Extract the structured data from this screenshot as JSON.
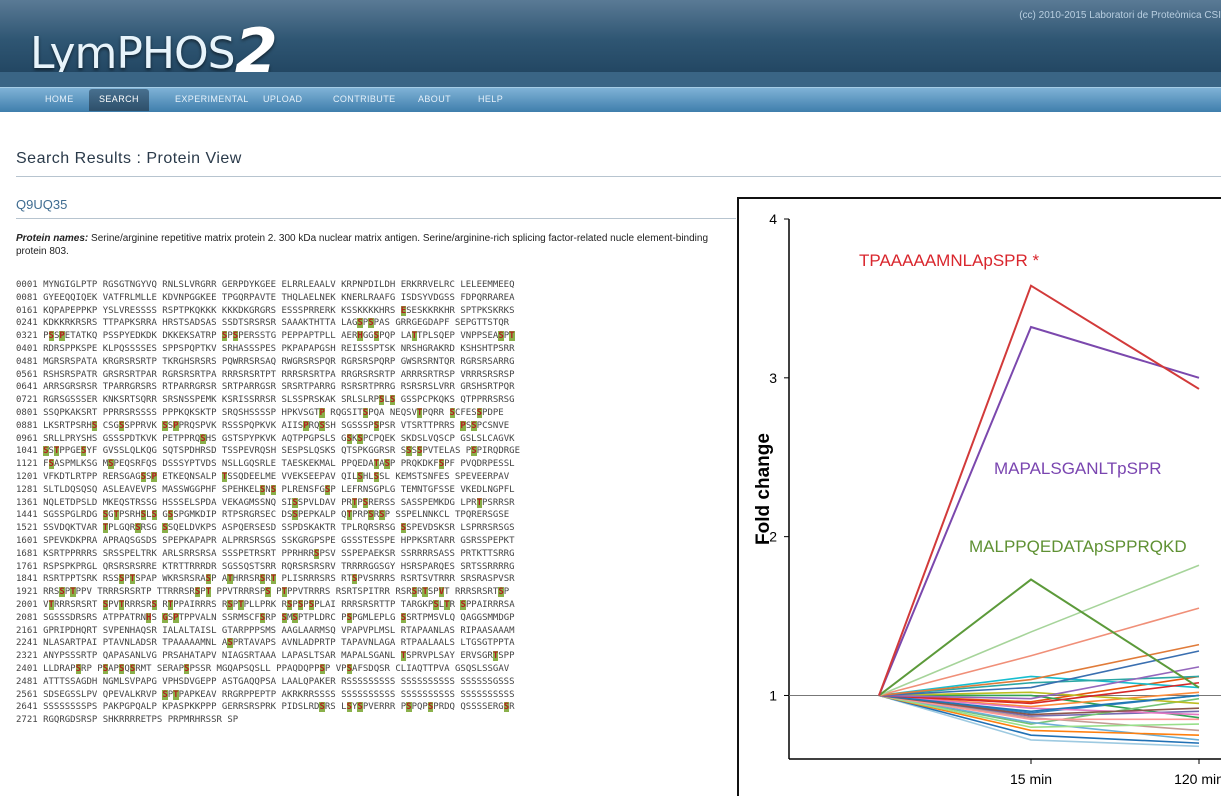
{
  "app": {
    "logo_text": "LymPHOS",
    "logo_number": "2",
    "copyright": "(cc) 2010-2015 Laboratori de Proteòmica CSI"
  },
  "nav": {
    "items": [
      "HOME",
      "SEARCH",
      "EXPERIMENTAL",
      "UPLOAD",
      "CONTRIBUTE",
      "ABOUT",
      "HELP"
    ],
    "active": "SEARCH"
  },
  "page": {
    "title": "Search Results : Protein View",
    "accession": "Q9UQ35",
    "protein_names_label": "Protein names:",
    "protein_names_text": "Serine/arginine repetitive matrix protein 2. 300 kDa nuclear matrix antigen. Serine/arginine-rich splicing factor-related nucle element-binding protein 803."
  },
  "sequence_lines": [
    [
      {
        "t": "0001 MYNGIGLPTP RGSGTNGYVQ RNLSLVRGRR GERPDYKGEE ELRRLEAALV KRPNPDILDH ERKRRVELRC LELEEMMEEQ"
      }
    ],
    [
      {
        "t": "0081 GYEEQQIQEK VATFRLMLLE KDVNPGGKEE TPGQRPAVTE THQLAELNEK KNERLRAAFG ISDSYVDGSS FDPQRRAREA"
      }
    ],
    [
      {
        "t": "0161 KQPAPEPPKP YSLVRESSSS RSPTPKQKKK KKKDKGRGRS ESSSPRRERK KSSKKKKHRS "
      },
      {
        "t": "E",
        "h": 1
      },
      {
        "t": "SESKKRKHR SPTPKSKRKS"
      }
    ],
    [
      {
        "t": "0241 KDKKRKRSRS TTPAPKSRRA HRSTSADSAS SSDTSRSRSR SAAAKTHTTA LAG"
      },
      {
        "t": "S",
        "h": 1
      },
      {
        "t": "P"
      },
      {
        "t": "S",
        "h": 1
      },
      {
        "t": "PAS GRRGEGDAPF SEPGTTSTQR"
      }
    ],
    [
      {
        "t": "0321 P"
      },
      {
        "t": "S",
        "h": 1
      },
      {
        "t": "S"
      },
      {
        "t": "P",
        "h": 1
      },
      {
        "t": "ETATKQ PSSPYEDKDK DKKEKSATRP "
      },
      {
        "t": "S",
        "h": 1
      },
      {
        "t": "P"
      },
      {
        "t": "S",
        "h": 1
      },
      {
        "t": "PERSSTG PEPPAPTPLL AER"
      },
      {
        "t": "H",
        "h": 1
      },
      {
        "t": "GG"
      },
      {
        "t": "S",
        "h": 1
      },
      {
        "t": "PQP LA"
      },
      {
        "t": "T",
        "h": 1
      },
      {
        "t": "TPLSQEP VNPPSEA"
      },
      {
        "t": "S",
        "h": 1
      },
      {
        "t": "P"
      },
      {
        "t": "T",
        "h": 1
      }
    ],
    [
      {
        "t": "0401 RDRSPPKSPE KLPQSSSSES SPPSPQPTKV SRHASSSPES PKPAPAPGSH REISSSPTSK NRSHGRAKRD KSHSHTPSRR"
      }
    ],
    [
      {
        "t": "0481 MGRSRSPATA KRGRSRSRTP TKRGHSRSRS PQWRRSRSAQ RWGRSRSPQR RGRSRSPQRP GWSRSRNTQR RGRSRSARRG"
      }
    ],
    [
      {
        "t": "0561 RSHSRSPATR GRSRSRTPAR RGRSRSRTPA RRRSRSRTPT RRRSRSRTPA RRGRSRSRTP ARRRSRTRSP VRRRSRSRSP"
      }
    ],
    [
      {
        "t": "0641 ARRSGRSRSR TPARRGRSRS RTPARRGRSR SRTPARRGSR SRSRTPARRG RSRSRTPRRG RSRSRSLVRR GRSHSRTPQR"
      }
    ],
    [
      {
        "t": "0721 RGRSGSSSER KNKSRTSQRR SRSNSSPEMK KSRISSRRSR SLSSPRSKAK SRLSLRP"
      },
      {
        "t": "S",
        "h": 1
      },
      {
        "t": "L"
      },
      {
        "t": "S",
        "h": 1
      },
      {
        "t": " GSSPCPKQKS QTPPRRSRSG"
      }
    ],
    [
      {
        "t": "0801 SSQPKAKSRT PPRRSRSSSS PPPKQKSKTP SRQSHSSSSP HPKVSGT"
      },
      {
        "t": "P",
        "h": 1
      },
      {
        "t": " RQGSIT"
      },
      {
        "t": "S",
        "h": 1
      },
      {
        "t": "PQA NEQSV"
      },
      {
        "t": "T",
        "h": 1
      },
      {
        "t": "PQRR "
      },
      {
        "t": "S",
        "h": 1
      },
      {
        "t": "CFES"
      },
      {
        "t": "S",
        "h": 1
      },
      {
        "t": "PDPE"
      }
    ],
    [
      {
        "t": "0881 LKSRTPSRH"
      },
      {
        "t": "S",
        "h": 1
      },
      {
        "t": " CSG"
      },
      {
        "t": "S",
        "h": 1
      },
      {
        "t": "SPPRVK "
      },
      {
        "t": "S",
        "h": 1
      },
      {
        "t": "S"
      },
      {
        "t": "P",
        "h": 1
      },
      {
        "t": "PRQSPVK RSSSPQPKVK AIIS"
      },
      {
        "t": "P",
        "h": 1
      },
      {
        "t": "RQ"
      },
      {
        "t": "S",
        "h": 1
      },
      {
        "t": "SH SGSSSP"
      },
      {
        "t": "S",
        "h": 1
      },
      {
        "t": "PSR VTSRTTPRRS "
      },
      {
        "t": "P",
        "h": 1
      },
      {
        "t": "S"
      },
      {
        "t": "S",
        "h": 1
      },
      {
        "t": "PCSNVE"
      }
    ],
    [
      {
        "t": "0961 SRLLPRYSHS GSSSPDTKVK PETPPRQ"
      },
      {
        "t": "S",
        "h": 1
      },
      {
        "t": "HS GSTSPYPKVK AQTPPGPSLS G"
      },
      {
        "t": "S",
        "h": 1
      },
      {
        "t": "K"
      },
      {
        "t": "S",
        "h": 1
      },
      {
        "t": "PCPQEK SKDSLVQSCP GSLSLCAGVK"
      }
    ],
    [
      {
        "t": "1041 "
      },
      {
        "t": "S",
        "h": 1
      },
      {
        "t": "S"
      },
      {
        "t": "T",
        "h": 1
      },
      {
        "t": "PPGE"
      },
      {
        "t": "S",
        "h": 1
      },
      {
        "t": "YF GVSSLQLKQG SQTSPDHRSD TSSPEVRQSH SESPSLQSKS QTSPKGGRSR S"
      },
      {
        "t": "S",
        "h": 1
      },
      {
        "t": "S"
      },
      {
        "t": "S",
        "h": 1
      },
      {
        "t": "PVTELAS P"
      },
      {
        "t": "S",
        "h": 1
      },
      {
        "t": "PIRQDRGE"
      }
    ],
    [
      {
        "t": "1121 F"
      },
      {
        "t": "S",
        "h": 1
      },
      {
        "t": "ASPMLKSG M"
      },
      {
        "t": "S",
        "h": 1
      },
      {
        "t": "PEQSRFQS DSSSYPTVDS NSLLGQSRLE TAESKEKMAL PPQEDA"
      },
      {
        "t": "T",
        "h": 1
      },
      {
        "t": "A"
      },
      {
        "t": "S",
        "h": 1
      },
      {
        "t": "P PRQKDKF"
      },
      {
        "t": "S",
        "h": 1
      },
      {
        "t": "PF PVQDRPESSL"
      }
    ],
    [
      {
        "t": "1201 VFKDTLRTPP RERSGAG"
      },
      {
        "t": "S",
        "h": 1
      },
      {
        "t": "S"
      },
      {
        "t": "P",
        "h": 1
      },
      {
        "t": " ETKEQNSALP "
      },
      {
        "t": "T",
        "h": 1
      },
      {
        "t": "SSQDEELME VVEKSEEPAV QIL"
      },
      {
        "t": "S",
        "h": 1
      },
      {
        "t": "HL"
      },
      {
        "t": "S",
        "h": 1
      },
      {
        "t": "SL KEMSTSNFES SPEVEERPAV"
      }
    ],
    [
      {
        "t": "1281 SLTLDQSQSQ ASLEAVEVPS MASSWGGPHF SPEHKEL"
      },
      {
        "t": "S",
        "h": 1
      },
      {
        "t": "N"
      },
      {
        "t": "S",
        "h": 1
      },
      {
        "t": " PLRENSFG"
      },
      {
        "t": "S",
        "h": 1
      },
      {
        "t": "P LEFRNSGPLG TEMNTGFSSE VKEDLNGPFL"
      }
    ],
    [
      {
        "t": "1361 NQLETDPSLD MKEQSTRSSG HSSSELSPDA VEKAGMSSNQ SI"
      },
      {
        "t": "S",
        "h": 1
      },
      {
        "t": "SPVLDAV PR"
      },
      {
        "t": "T",
        "h": 1
      },
      {
        "t": "P"
      },
      {
        "t": "S",
        "h": 1
      },
      {
        "t": "RERSS SASSPEMKDG LPR"
      },
      {
        "t": "T",
        "h": 1
      },
      {
        "t": "PSRRSR"
      }
    ],
    [
      {
        "t": "1441 SGSSPGLRDG "
      },
      {
        "t": "S",
        "h": 1
      },
      {
        "t": "G"
      },
      {
        "t": "T",
        "h": 1
      },
      {
        "t": "PSRH"
      },
      {
        "t": "S",
        "h": 1
      },
      {
        "t": "L"
      },
      {
        "t": "S",
        "h": 1
      },
      {
        "t": " G"
      },
      {
        "t": "S",
        "h": 1
      },
      {
        "t": "SPGMKDIP RTPSRGRSEC DS"
      },
      {
        "t": "S",
        "h": 1
      },
      {
        "t": "PEPKALP Q"
      },
      {
        "t": "T",
        "h": 1
      },
      {
        "t": "PRP"
      },
      {
        "t": "S",
        "h": 1
      },
      {
        "t": "R"
      },
      {
        "t": "S",
        "h": 1
      },
      {
        "t": "P SSPELNNKCL TPQRERSGSE"
      }
    ],
    [
      {
        "t": "1521 SSVDQKTVAR "
      },
      {
        "t": "T",
        "h": 1
      },
      {
        "t": "PLGQR"
      },
      {
        "t": "S",
        "h": 1
      },
      {
        "t": "RSG "
      },
      {
        "t": "S",
        "h": 1
      },
      {
        "t": "SQELDVKPS ASPQERSESD SSPDSKAKTR TPLRQRSRSG "
      },
      {
        "t": "S",
        "h": 1
      },
      {
        "t": "SPEVDSKSR LSPRRSRSGS"
      }
    ],
    [
      {
        "t": "1601 SPEVKDKPRA APRAQSGSDS SPEPKAPAPR ALPRRSRSGS SSKGRGPSPE GSSSTESSPE HPPKSRTARR GSRSSPEPKT"
      }
    ],
    [
      {
        "t": "1681 KSRTPPRRRS SRSSPELTRK ARLSRRSRSA SSSPETRSRT PPRHRR"
      },
      {
        "t": "S",
        "h": 1
      },
      {
        "t": "PSV SSPEPAEKSR SSRRRRSASS PRTKTTSRRG"
      }
    ],
    [
      {
        "t": "1761 RSPSPKPRGL QRSRSRSRRE KTRTTRRRDR SGSSQSTSRR RQRSRSRSRV TRRRRGGSGY HSRSPARQES SRTSSRRRRG"
      }
    ],
    [
      {
        "t": "1841 RSRTPPTSRK RSS"
      },
      {
        "t": "S",
        "h": 1
      },
      {
        "t": "P"
      },
      {
        "t": "T",
        "h": 1
      },
      {
        "t": "SPAP WKRSRSRA"
      },
      {
        "t": "S",
        "h": 1
      },
      {
        "t": "P A"
      },
      {
        "t": "T",
        "h": 1
      },
      {
        "t": "HRRSR"
      },
      {
        "t": "S",
        "h": 1
      },
      {
        "t": "R"
      },
      {
        "t": "T",
        "h": 1
      },
      {
        "t": " PLISRRRSRS RT"
      },
      {
        "t": "S",
        "h": 1
      },
      {
        "t": "PVSRRRS RSRTSVTRRR SRSRASPVSR"
      }
    ],
    [
      {
        "t": "1921 RRS"
      },
      {
        "t": "S",
        "h": 1
      },
      {
        "t": "P"
      },
      {
        "t": "T",
        "h": 1
      },
      {
        "t": "PPV TRRRSRSRTP TTRRRSR"
      },
      {
        "t": "S",
        "h": 1
      },
      {
        "t": "P"
      },
      {
        "t": "T",
        "h": 1
      },
      {
        "t": " PPVTRRRSP"
      },
      {
        "t": "S",
        "h": 1
      },
      {
        "t": " P"
      },
      {
        "t": "T",
        "h": 1
      },
      {
        "t": "PPVTRRRS RSRTSPITRR RSR"
      },
      {
        "t": "S",
        "h": 1
      },
      {
        "t": "R"
      },
      {
        "t": "T",
        "h": 1
      },
      {
        "t": "SP"
      },
      {
        "t": "V",
        "h": 1
      },
      {
        "t": "T RRRSRSRT"
      },
      {
        "t": "S",
        "h": 1
      },
      {
        "t": "P"
      }
    ],
    [
      {
        "t": "2001 V"
      },
      {
        "t": "T",
        "h": 1
      },
      {
        "t": "RRRSRSRT "
      },
      {
        "t": "S",
        "h": 1
      },
      {
        "t": "PV"
      },
      {
        "t": "T",
        "h": 1
      },
      {
        "t": "RRRSR"
      },
      {
        "t": "S",
        "h": 1
      },
      {
        "t": " R"
      },
      {
        "t": "T",
        "h": 1
      },
      {
        "t": "PPAIRRRS R"
      },
      {
        "t": "S",
        "h": 1
      },
      {
        "t": "P"
      },
      {
        "t": "T",
        "h": 1
      },
      {
        "t": "PLLPRK R"
      },
      {
        "t": "S",
        "h": 1
      },
      {
        "t": "P"
      },
      {
        "t": "S",
        "h": 1
      },
      {
        "t": "P"
      },
      {
        "t": "S",
        "h": 1
      },
      {
        "t": "PLAI RRRSRSRTTP TARGKP"
      },
      {
        "t": "S",
        "h": 1
      },
      {
        "t": "L"
      },
      {
        "t": "T",
        "h": 1
      },
      {
        "t": "R "
      },
      {
        "t": "S",
        "h": 1
      },
      {
        "t": "PPAIRRRSA"
      }
    ],
    [
      {
        "t": "2081 SGSSSDRSRS ATPPATRN"
      },
      {
        "t": "H",
        "h": 1
      },
      {
        "t": "S "
      },
      {
        "t": "G",
        "h": 1
      },
      {
        "t": "S"
      },
      {
        "t": "P",
        "h": 1
      },
      {
        "t": "TPPVALN SSRMSCF"
      },
      {
        "t": "S",
        "h": 1
      },
      {
        "t": "RP "
      },
      {
        "t": "S",
        "h": 1
      },
      {
        "t": "M"
      },
      {
        "t": "S",
        "h": 1
      },
      {
        "t": "PTPLDRC P"
      },
      {
        "t": "S",
        "h": 1
      },
      {
        "t": "PGMLEPLG "
      },
      {
        "t": "S",
        "h": 1
      },
      {
        "t": "SRTPMSVLQ QAGGSMMDGP"
      }
    ],
    [
      {
        "t": "2161 GPRIPDHQRT SVPENHAQSR IALALTAISL GTARPPPSMS AAGLAARMSQ VPAPVPLMSL RTAPAANLAS RIPAASAAAM"
      }
    ],
    [
      {
        "t": "2241 NLASARTPAI PTAVNLADSR TPAAAAAMNL A"
      },
      {
        "t": "S",
        "h": 1
      },
      {
        "t": "PRTAVAPS AVNLADPRTP TAPAVNLAGA RTPAALAALS LTGSGTPPTA"
      }
    ],
    [
      {
        "t": "2321 ANYPSSSRTP QAPASANLVG PRSAHATAPV NIAGSRTAAA LAPASLTSAR MAPALSGANL "
      },
      {
        "t": "T",
        "h": 1
      },
      {
        "t": "SPRVPLSAY ERVSGR"
      },
      {
        "t": "T",
        "h": 1
      },
      {
        "t": "SPP"
      }
    ],
    [
      {
        "t": "2401 LLDRAP"
      },
      {
        "t": "S",
        "h": 1
      },
      {
        "t": "RP P"
      },
      {
        "t": "S",
        "h": 1
      },
      {
        "t": "AP"
      },
      {
        "t": "S",
        "h": 1
      },
      {
        "t": "Q"
      },
      {
        "t": "S",
        "h": 1
      },
      {
        "t": "RMT SERAP"
      },
      {
        "t": "S",
        "h": 1
      },
      {
        "t": "PSSR MGQAPSQSLL PPAQDQPP"
      },
      {
        "t": "S",
        "h": 1
      },
      {
        "t": "P VP"
      },
      {
        "t": "S",
        "h": 1
      },
      {
        "t": "AFSDQSR CLIAQTTPVA GSQSLSSGAV"
      }
    ],
    [
      {
        "t": "2481 ATTTSSAGDH NGMLSVPAPG VPHSDVGEPP ASTGAQQPSA LAALQPAKER RSSSSSSSSS SSSSSSSSSS SSSSSSGSSS"
      }
    ],
    [
      {
        "t": "2561 SDSEGSSLPV QPEVALKRVP "
      },
      {
        "t": "S",
        "h": 1
      },
      {
        "t": "P"
      },
      {
        "t": "T",
        "h": 1
      },
      {
        "t": "PAPKEAV RRGRPPEPTP AKRKRRSSSS SSSSSSSSSS SSSSSSSSSS SSSSSSSSSS"
      }
    ],
    [
      {
        "t": "2641 SSSSSSSSPS PAKPGPQALP KPASPKKPPP GERRSRSPRK PIDSLRD"
      },
      {
        "t": "S",
        "h": 1
      },
      {
        "t": "RS L"
      },
      {
        "t": "S",
        "h": 1
      },
      {
        "t": "Y"
      },
      {
        "t": "S",
        "h": 1
      },
      {
        "t": "PVERRR P"
      },
      {
        "t": "S",
        "h": 1
      },
      {
        "t": "PQP"
      },
      {
        "t": "S",
        "h": 1
      },
      {
        "t": "PRDQ QSSSSERG"
      },
      {
        "t": "S",
        "h": 1
      },
      {
        "t": "R"
      }
    ],
    [
      {
        "t": "2721 RGQRGDSRSP SHKRRRRETPS PRPMRHRSSR SP"
      }
    ]
  ],
  "chart_data": {
    "type": "line",
    "ylabel": "Fold change",
    "xlabel": "",
    "categories": [
      "",
      "15 min",
      "120 min"
    ],
    "ylim": [
      0.6,
      4.0
    ],
    "yticks": [
      1,
      2,
      3,
      4
    ],
    "grid": false,
    "reference_line": 1,
    "annotations": [
      {
        "text": "TPAAAAAMNLApSPR *",
        "color": "#d9262d"
      },
      {
        "text": "MAPALSGANLTpSPR",
        "color": "#7a45b0"
      },
      {
        "text": "MALPPQEDATApSPPRQKD",
        "color": "#5f9133"
      }
    ],
    "series": [
      {
        "values": [
          1.0,
          3.58,
          2.93
        ],
        "color": "#d23a3a"
      },
      {
        "values": [
          1.0,
          3.32,
          3.0
        ],
        "color": "#7b48ad"
      },
      {
        "values": [
          1.0,
          1.73,
          1.05
        ],
        "color": "#5c9a3a"
      },
      {
        "values": [
          1.0,
          1.4,
          1.82
        ],
        "color": "#a6d49a"
      },
      {
        "values": [
          1.0,
          1.25,
          1.55
        ],
        "color": "#f08f78"
      },
      {
        "values": [
          1.0,
          1.1,
          1.32
        ],
        "color": "#e07b39"
      },
      {
        "values": [
          1.0,
          1.05,
          1.28
        ],
        "color": "#3a6fb0"
      },
      {
        "values": [
          1.0,
          0.98,
          1.18
        ],
        "color": "#9467bd"
      },
      {
        "values": [
          1.0,
          1.08,
          1.12
        ],
        "color": "#2ca6a4"
      },
      {
        "values": [
          1.0,
          0.95,
          1.08
        ],
        "color": "#d62728"
      },
      {
        "values": [
          1.0,
          1.12,
          1.05
        ],
        "color": "#17becf"
      },
      {
        "values": [
          1.0,
          0.9,
          1.0
        ],
        "color": "#1f77b4"
      },
      {
        "values": [
          1.0,
          1.02,
          0.95
        ],
        "color": "#bcbd22"
      },
      {
        "values": [
          1.0,
          0.88,
          0.92
        ],
        "color": "#8c564b"
      },
      {
        "values": [
          1.0,
          0.92,
          0.88
        ],
        "color": "#e377c2"
      },
      {
        "values": [
          1.0,
          0.85,
          0.85
        ],
        "color": "#ff9896"
      },
      {
        "values": [
          1.0,
          0.8,
          0.82
        ],
        "color": "#98df8a"
      },
      {
        "values": [
          1.0,
          0.86,
          0.78
        ],
        "color": "#c49c94"
      },
      {
        "values": [
          1.0,
          0.78,
          0.75
        ],
        "color": "#ff7f0e"
      },
      {
        "values": [
          1.0,
          0.83,
          0.72
        ],
        "color": "#6baed6"
      },
      {
        "values": [
          1.0,
          0.75,
          0.7
        ],
        "color": "#2171b5"
      },
      {
        "values": [
          1.0,
          0.72,
          0.68
        ],
        "color": "#9ecae1"
      },
      {
        "values": [
          1.0,
          0.82,
          0.98
        ],
        "color": "#74c476"
      },
      {
        "values": [
          1.0,
          0.93,
          1.02
        ],
        "color": "#fd8d3c"
      },
      {
        "values": [
          1.0,
          0.87,
          0.9
        ],
        "color": "#756bb1"
      },
      {
        "values": [
          1.0,
          1.0,
          0.86
        ],
        "color": "#31a354"
      },
      {
        "values": [
          1.0,
          0.96,
          1.12
        ],
        "color": "#e6550d"
      },
      {
        "values": [
          1.0,
          0.89,
          1.0
        ],
        "color": "#3182bd"
      }
    ]
  }
}
